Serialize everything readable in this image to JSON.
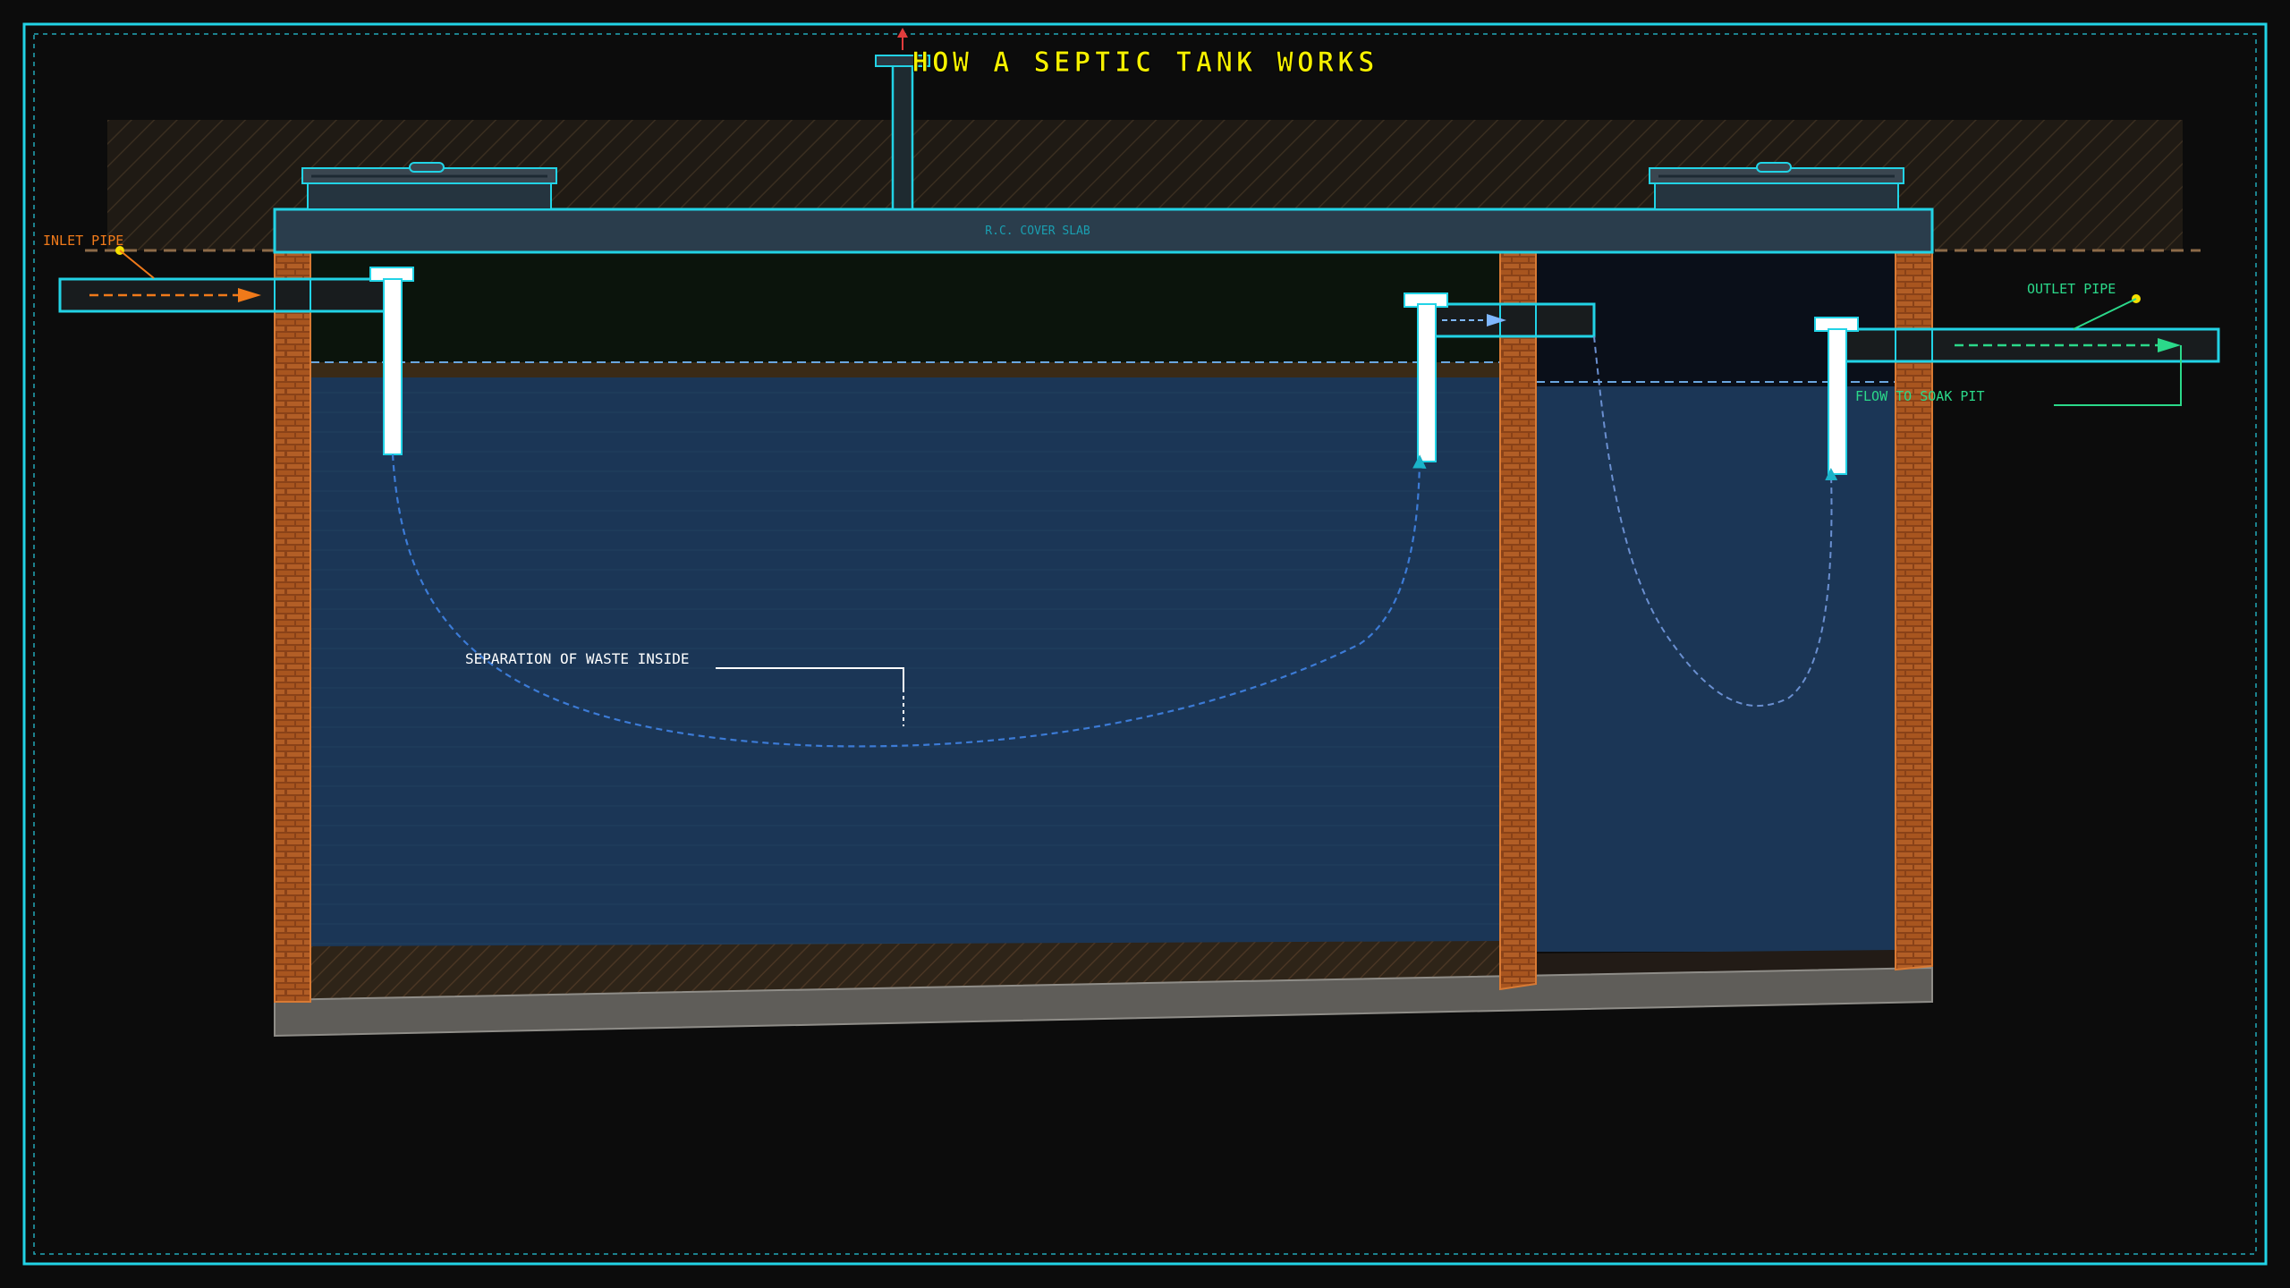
{
  "title": "HOW A SEPTIC TANK WORKS",
  "labels": {
    "inlet_pipe": "INLET PIPE",
    "outlet_pipe": "OUTLET PIPE",
    "cover_slab": "R.C. COVER SLAB",
    "separation": "SEPARATION OF WASTE INSIDE",
    "flow_to_soak_pit": "FLOW TO SOAK PIT"
  },
  "colors": {
    "frame": "#22d3e6",
    "title": "#f5f000",
    "inlet": "#f07a1a",
    "outlet": "#2bd98a",
    "water": "#1b3656",
    "brick": "#a5531f",
    "flow_path": "#3c7bd6"
  }
}
